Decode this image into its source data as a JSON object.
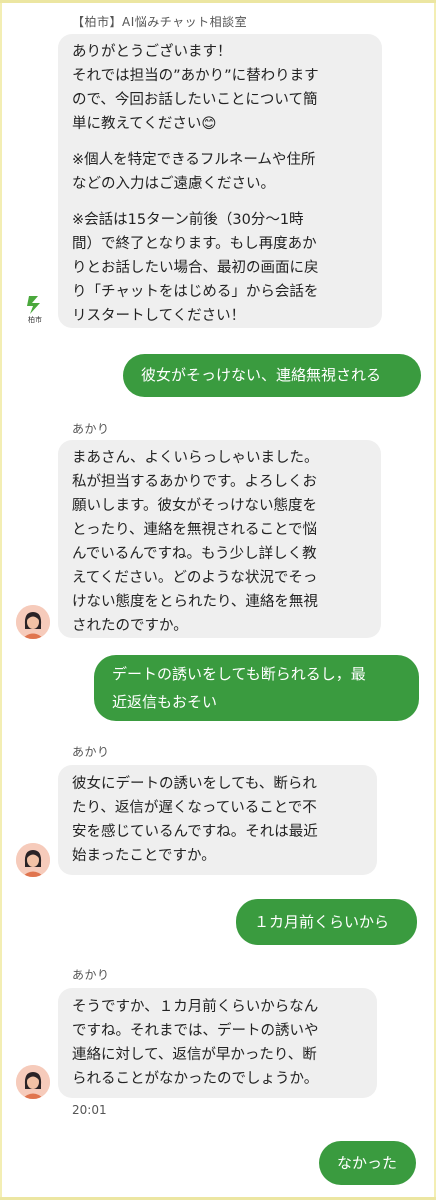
{
  "header": {
    "title": "【柏市】AI悩みチャット相談室"
  },
  "messages": [
    {
      "role": "bot",
      "logo_text": "柏市",
      "paragraphs": [
        [
          "ありがとうございます！",
          "それでは担当の”あかり”に替わります",
          "ので、今回お話したいことについて簡",
          "単に教えてください😊"
        ],
        [
          "※個人を特定できるフルネームや住所",
          "などの入力はご遠慮ください。"
        ],
        [
          "※会話は15ターン前後（30分〜1時",
          "間）で終了となります。もし再度あか",
          "りとお話したい場合、最初の画面に戻",
          "り「チャットをはじめる」から会話を",
          "リスタートしてください！"
        ]
      ]
    },
    {
      "role": "user",
      "text": "彼女がそっけない、連絡無視される"
    },
    {
      "role": "akari",
      "sender": "あかり",
      "lines": [
        "まあさん、よくいらっしゃいました。",
        "私が担当するあかりです。よろしくお",
        "願いします。彼女がそっけない態度を",
        "とったり、連絡を無視されることで悩",
        "んでいるんですね。もう少し詳しく教",
        "えてください。どのような状況でそっ",
        "けない態度をとられたり、連絡を無視",
        "されたのですか。"
      ]
    },
    {
      "role": "user",
      "lines": [
        "デートの誘いをしても断られるし，最",
        "近返信もおそい"
      ]
    },
    {
      "role": "akari",
      "sender": "あかり",
      "lines": [
        "彼女にデートの誘いをしても、断られ",
        "たり、返信が遅くなっていることで不",
        "安を感じているんですね。それは最近",
        "始まったことですか。"
      ]
    },
    {
      "role": "user",
      "text": "１カ月前くらいから"
    },
    {
      "role": "akari",
      "sender": "あかり",
      "lines": [
        "そうですか、１カ月前くらいからなん",
        "ですね。それまでは、デートの誘いや",
        "連絡に対して、返信が早かったり、断",
        "られることがなかったのでしょうか。"
      ],
      "time": "20:01"
    },
    {
      "role": "user",
      "text": "なかった"
    }
  ]
}
